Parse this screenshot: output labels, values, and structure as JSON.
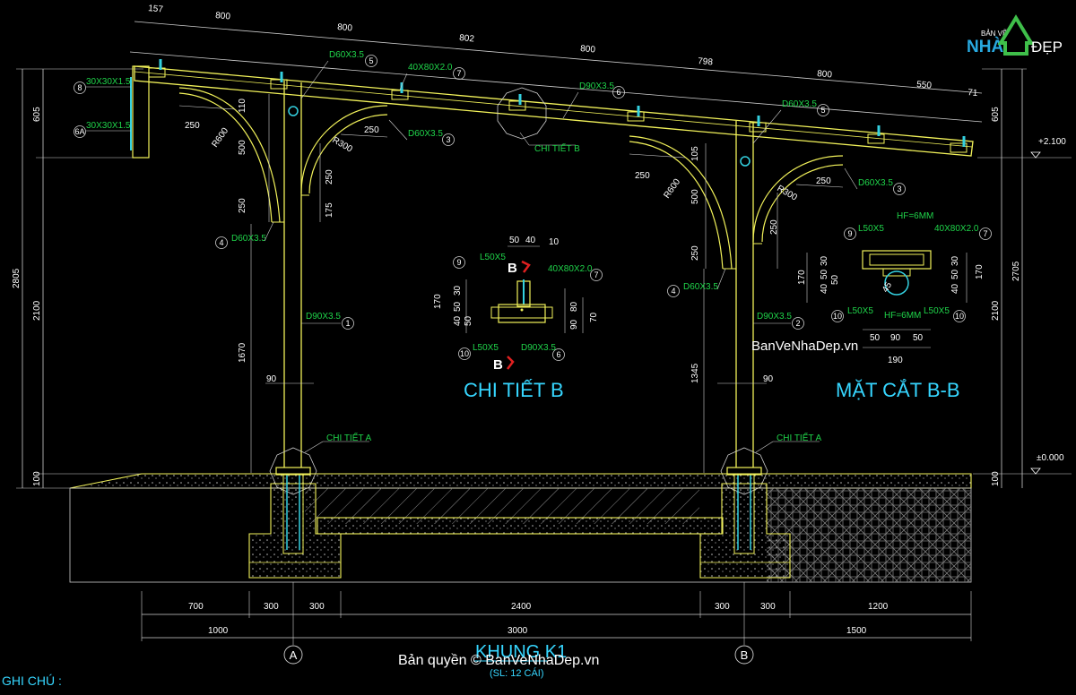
{
  "logo": {
    "top": "BẢN VẼ",
    "nha": "NHÀ",
    "dep": "ĐẸP",
    "colors": {
      "nha": "#28a9e0",
      "dep": "#ffffff",
      "house": "#3fbf4a"
    }
  },
  "top_dims": [
    "157",
    "800",
    "800",
    "802",
    "800",
    "798",
    "800",
    "550",
    "71"
  ],
  "left_dims": [
    "605",
    "2805",
    "2100",
    "100"
  ],
  "right_dims": [
    "605",
    "2705",
    "2100",
    "100"
  ],
  "levels": {
    "top": "+2.100",
    "ground": "±0.000"
  },
  "members": {
    "m8": {
      "text": "30X30X1.5",
      "num": "8"
    },
    "m6a": {
      "text": "30X30X1.5",
      "num": "6A"
    },
    "m5a": {
      "text": "D60X3.5",
      "num": "5"
    },
    "m7a": {
      "text": "40X80X2.0",
      "num": "7"
    },
    "m6": {
      "text": "D90X3.5",
      "num": "6"
    },
    "m3a": {
      "text": "D60X3.5",
      "num": "3"
    },
    "m5b": {
      "text": "D60X3.5",
      "num": "5"
    },
    "m3b": {
      "text": "D60X3.5",
      "num": "3"
    },
    "m4a": {
      "text": "D60X3.5",
      "num": "4"
    },
    "m4b": {
      "text": "D60X3.5",
      "num": "4"
    },
    "m1": {
      "text": "D90X3.5",
      "num": "1"
    },
    "m2": {
      "text": "D90X3.5",
      "num": "2"
    }
  },
  "frame_dims": {
    "d250a": "250",
    "r600a": "R600",
    "d110": "110",
    "d500a": "500",
    "d250b": "250",
    "r300a": "R300",
    "d250c": "250",
    "d250d": "250",
    "d175": "175",
    "d1670": "1670",
    "d90a": "90",
    "d250e": "250",
    "r600b": "R600",
    "d105": "105",
    "d500b": "500",
    "d250f": "250",
    "r300b": "R300",
    "d250g": "250",
    "d250h": "250",
    "d1345": "1345",
    "d90b": "90"
  },
  "chi_tiet_b_label": "CHI TIẾT B",
  "chi_tiet_a_label": "CHI TIẾT A",
  "detail_b": {
    "title": "CHI TIẾT B",
    "section_mark": "B",
    "l50x5": "L50X5",
    "tube": "40X80X2.0",
    "pipe": "D90X3.5",
    "nums": {
      "n9": "9",
      "n7": "7",
      "n10": "10",
      "n6": "6"
    },
    "dims": {
      "a": "50",
      "b": "40",
      "c": "10",
      "h170": "170",
      "h30": "30",
      "h50": "50",
      "h40": "40",
      "h50b": "50",
      "h80": "80",
      "h90": "90",
      "h70": "70"
    }
  },
  "section_bb": {
    "title": "MẶT CẮT B-B",
    "hf_top": "HF=6MM",
    "hf_bot": "HF=6MM",
    "l50x5": "L50X5",
    "tube": "40X80X2.0",
    "d45": "45",
    "nums": {
      "n9": "9",
      "n7": "7",
      "n10a": "10",
      "n10b": "10"
    },
    "dims": {
      "h170a": "170",
      "h30": "30",
      "h50": "50",
      "h40": "40",
      "h50b": "50",
      "h30b": "30",
      "h50c": "50",
      "h40b": "40",
      "h170b": "170",
      "b50a": "50",
      "b90": "90",
      "b50b": "50",
      "b190": "190"
    }
  },
  "bottom_dims_row1": [
    "700",
    "300",
    "300",
    "2400",
    "300",
    "300",
    "1200"
  ],
  "bottom_dims_row2": [
    "1000",
    "3000",
    "1500"
  ],
  "axes": [
    "A",
    "B"
  ],
  "frame_title": "KHUNG K1",
  "frame_sub": "(SL: 12 CÁI)",
  "note": "GHI CHÚ :",
  "watermark_mid": "BanVeNhaDep.vn",
  "watermark_bottom": "Bản quyền © BanVeNhaDep.vn"
}
